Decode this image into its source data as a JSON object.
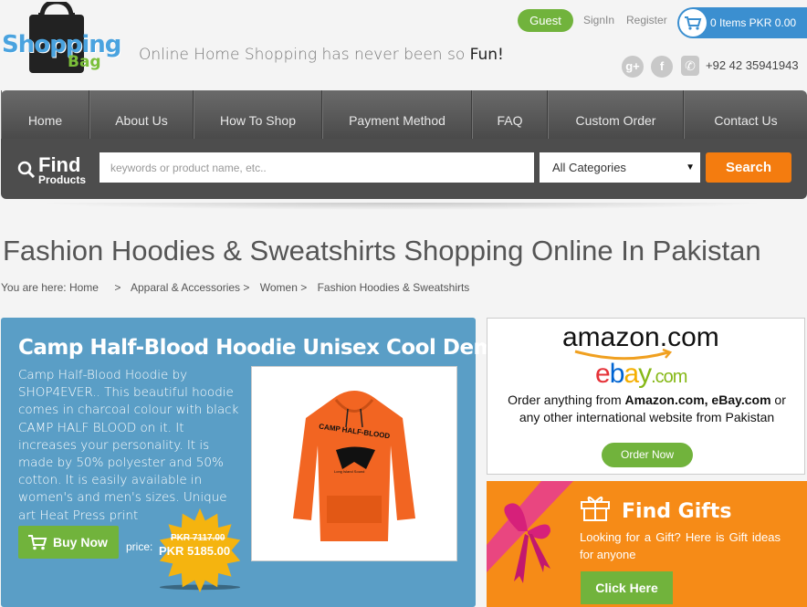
{
  "header": {
    "logo_top": "Shopping",
    "logo_bottom": "Bag",
    "tagline": "Online Home Shopping has never been so",
    "tagline_emph": "Fun!",
    "guest": "Guest",
    "signin": "SignIn",
    "register": "Register",
    "cart_text": "0 Items PKR 0.00",
    "phone": "+92 42 35941943"
  },
  "nav": {
    "items": [
      "Home",
      "About Us",
      "How To Shop",
      "Payment Method",
      "FAQ",
      "Custom Order",
      "Contact Us"
    ]
  },
  "search": {
    "find_big": "Find",
    "find_small": "Products",
    "placeholder": "keywords or product name, etc..",
    "category": "All Categories",
    "button": "Search"
  },
  "page": {
    "title": "Fashion Hoodies & Sweatshirts Shopping Online In Pakistan",
    "breadcrumb": [
      "You are here: Home",
      ">",
      "Apparal & Accessories >",
      "Women >",
      "Fashion Hoodies & Sweatshirts"
    ]
  },
  "feature": {
    "title": "Camp Half-Blood Hoodie Unisex Cool Dem",
    "description": "Camp Half-Blood Hoodie by SHOP4EVER.. This beautiful hoodie comes in charcoal colour with black CAMP HALF BLOOD on it. It increases your personality. It is made by 50% polyester and 50% cotton. It is easily available in women's and men's sizes. Unique art Heat Press print",
    "buy_now": "Buy Now",
    "price_label": "price:",
    "price_old": "PKR 7117.00",
    "price_new": "PKR 5185.00",
    "hoodie_print": "CAMP HALF-BLOOD",
    "hoodie_sub": "Long Island Sound"
  },
  "amazon": {
    "amazon_logo": "amazon.com",
    "ebay_e": "e",
    "ebay_b": "b",
    "ebay_a": "a",
    "ebay_y": "y",
    "ebay_com": ".com",
    "line1": "Order anything from",
    "line1_b": "Amazon.com,",
    "line2_b": "eBay.com",
    "line2": "or any other international website from Pakistan",
    "button": "Order Now"
  },
  "gifts": {
    "title": "Find Gifts",
    "text": "Looking for a Gift? Here is Gift ideas for anyone",
    "button": "Click Here"
  },
  "colors": {
    "green": "#71b33c",
    "orange": "#f47c0f",
    "blue_panel": "#5a9ec6",
    "cart_blue": "#3b8fd0"
  }
}
